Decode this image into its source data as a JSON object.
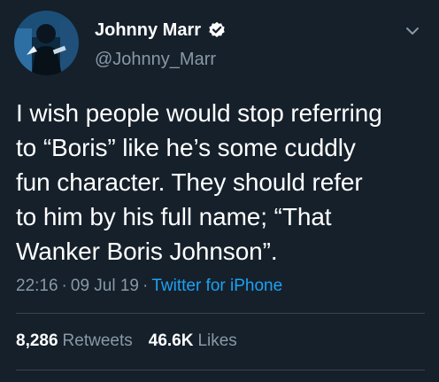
{
  "tweet": {
    "display_name": "Johnny Marr",
    "handle": "@Johnny_Marr",
    "verified": true,
    "text_lines": [
      "I wish people would stop referring",
      "to “Boris” like he’s some cuddly",
      "fun character. They should refer",
      "to him by his full name; “That",
      "Wanker Boris Johnson”."
    ],
    "time": "22:16",
    "date": "09 Jul 19",
    "separator": "·",
    "source": "Twitter for iPhone",
    "retweets_count": "8,286",
    "retweets_label": "Retweets",
    "likes_count": "46.6K",
    "likes_label": "Likes"
  },
  "icons": {
    "verified": "verified-badge-icon",
    "menu": "chevron-down-icon"
  },
  "colors": {
    "background": "#15202b",
    "text_primary": "#ffffff",
    "text_secondary": "#8899a6",
    "link": "#1da1f2",
    "divider": "#38444d"
  }
}
